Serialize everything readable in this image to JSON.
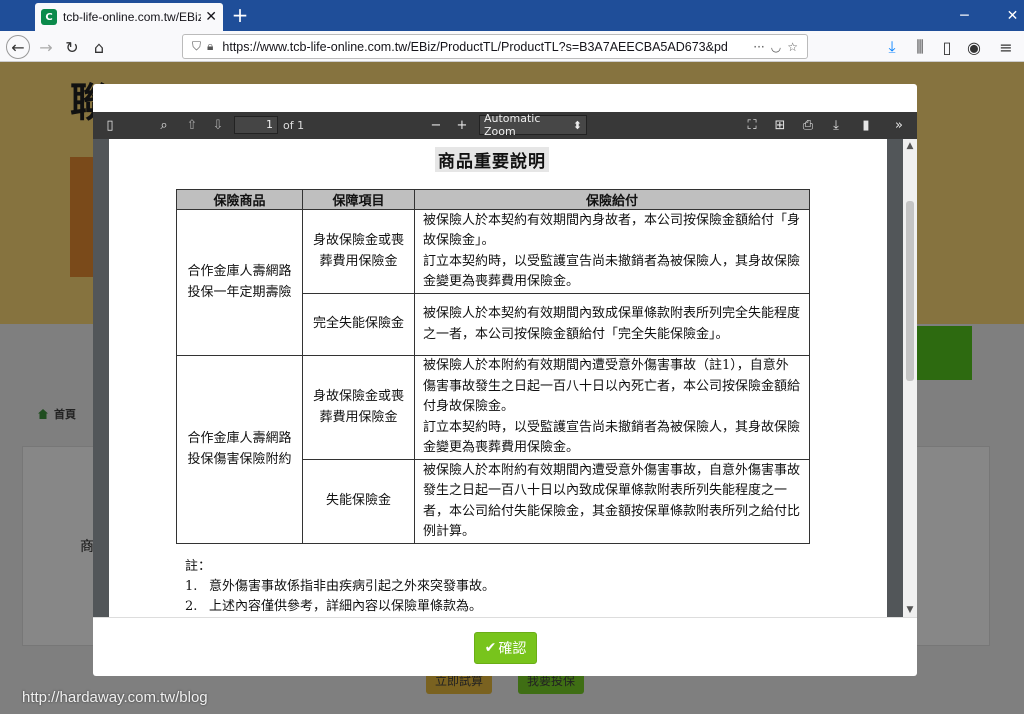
{
  "browser": {
    "tab_title": "tcb-life-online.com.tw/EBiz/P",
    "url": "https://www.tcb-life-online.com.tw/EBiz/ProductTL/ProductTL?s=B3A7AEECBA5AD673&pd"
  },
  "site": {
    "heading": "聯",
    "breadcrumb_home": "首頁",
    "partial_char": "商",
    "btn_trial": "立即試算",
    "btn_apply": "我要投保"
  },
  "pdf": {
    "page_number": "1",
    "page_of": "of 1",
    "zoom": "Automatic Zoom"
  },
  "doc": {
    "title": "商品重要說明",
    "headers": [
      "保險商品",
      "保障項目",
      "保險給付"
    ],
    "rows": [
      {
        "product": "合作金庫人壽網路投保一年定期壽險",
        "items": [
          {
            "item": "身故保險金或喪葬費用保險金",
            "benefit": "被保險人於本契約有效期間內身故者，本公司按保險金額給付「身故保險金」。\n訂立本契約時，以受監護宣告尚未撤銷者為被保險人，其身故保險金變更為喪葬費用保險金。"
          },
          {
            "item": "完全失能保險金",
            "benefit": "被保險人於本契約有效期間內致成保單條款附表所列完全失能程度之一者，本公司按保險金額給付「完全失能保險金」。"
          }
        ]
      },
      {
        "product": "合作金庫人壽網路投保傷害保險附約",
        "items": [
          {
            "item": "身故保險金或喪葬費用保險金",
            "benefit": "被保險人於本附約有效期間內遭受意外傷害事故（註1），自意外傷害事故發生之日起一百八十日以內死亡者，本公司按保險金額給付身故保險金。\n訂立本契約時，以受監護宣告尚未撤銷者為被保險人，其身故保險金變更為喪葬費用保險金。"
          },
          {
            "item": "失能保險金",
            "benefit": "被保險人於本附約有效期間內遭受意外傷害事故，自意外傷害事故發生之日起一百八十日以內致成保單條款附表所列失能程度之一者，本公司給付失能保險金，其金額按保單條款附表所列之給付比例計算。"
          }
        ]
      }
    ],
    "notes_label": "註：",
    "notes": [
      {
        "num": "1.",
        "text": "意外傷害事故係指非由疾病引起之外來突發事故。"
      },
      {
        "num": "2.",
        "text": "上述內容僅供參考，詳細內容以保險單條款為。"
      }
    ]
  },
  "footer": {
    "confirm_label": "確認"
  },
  "watermark": "http://hardaway.com.tw/blog"
}
